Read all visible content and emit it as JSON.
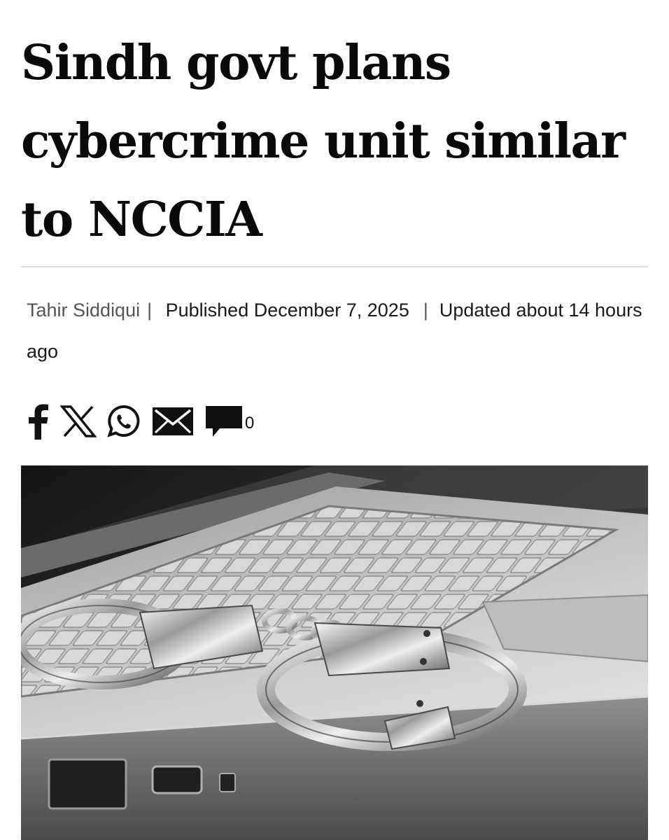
{
  "article": {
    "headline": "Sindh govt plans cybercrime unit similar to NCCIA",
    "author": "Tahir Siddiqui",
    "separator": "|",
    "published": "Published December 7, 2025",
    "updated": "Updated about 14 hours ago"
  },
  "share": {
    "icons": [
      "facebook-icon",
      "x-icon",
      "whatsapp-icon",
      "email-icon",
      "comment-icon"
    ],
    "comment_count": "0"
  },
  "colors": {
    "text": "#0a0a0a",
    "author": "#555555",
    "divider": "#dcdcdc"
  }
}
